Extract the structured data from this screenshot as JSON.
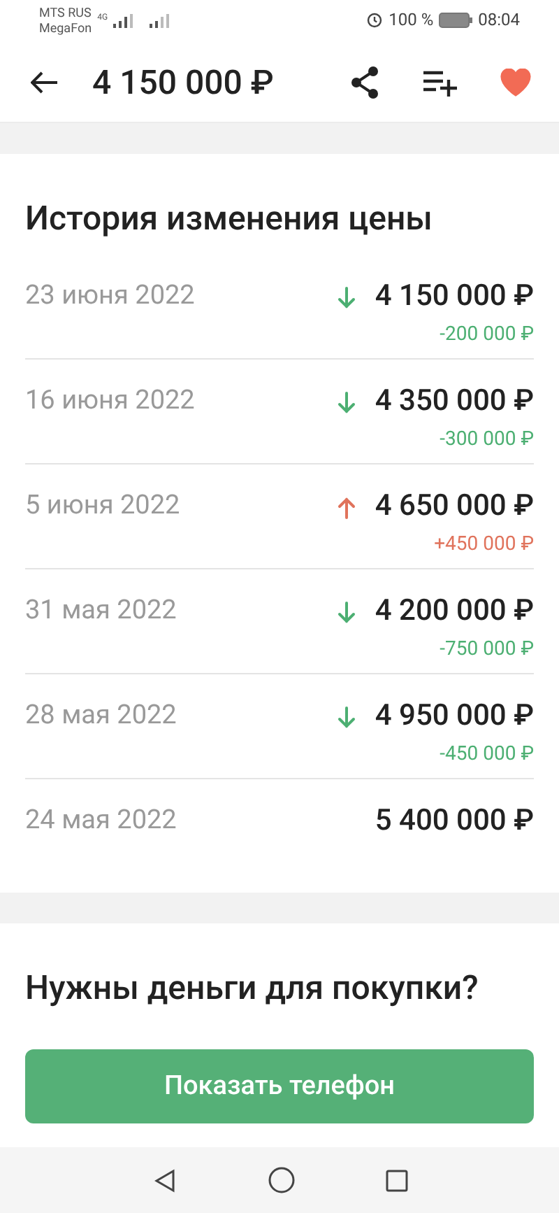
{
  "status_bar": {
    "carrier_1": "MTS RUS",
    "carrier_2": "MegaFon",
    "network": "4G",
    "battery": "100 %",
    "time": "08:04"
  },
  "header": {
    "title": "4 150 000 ₽",
    "favorite": true
  },
  "price_history": {
    "title": "История изменения цены",
    "rows": [
      {
        "date": "23 июня 2022",
        "price": "4 150 000 ₽",
        "change": "-200 000 ₽",
        "kind": "down"
      },
      {
        "date": "16 июня 2022",
        "price": "4 350 000 ₽",
        "change": "-300 000 ₽",
        "kind": "down"
      },
      {
        "date": "5 июня 2022",
        "price": "4 650 000 ₽",
        "change": "+450 000 ₽",
        "kind": "up"
      },
      {
        "date": "31 мая 2022",
        "price": "4 200 000 ₽",
        "change": "-750 000 ₽",
        "kind": "down"
      },
      {
        "date": "28 мая 2022",
        "price": "4 950 000 ₽",
        "change": "-450 000 ₽",
        "kind": "down"
      },
      {
        "date": "24 мая 2022",
        "price": "5 400 000 ₽",
        "kind": "initial"
      }
    ]
  },
  "mortgage": {
    "title": "Нужны деньги для покупки?"
  },
  "call_button": "Показать телефон"
}
